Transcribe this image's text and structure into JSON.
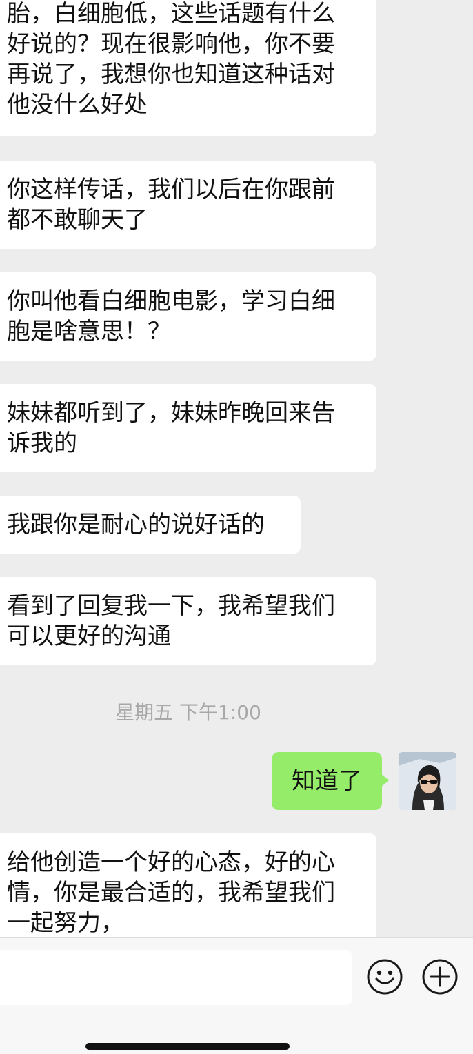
{
  "received_messages": [
    {
      "lines": [
        "胎，白细胞低，这些话题有什么",
        "好说的？现在很影响他，你不要",
        "再说了，我想你也知道这种话对",
        "他没什么好处"
      ]
    },
    {
      "lines": [
        "你这样传话，我们以后在你跟前",
        "都不敢聊天了"
      ]
    },
    {
      "lines": [
        "你叫他看白细胞电影，学习白细",
        "胞是啥意思！？"
      ]
    },
    {
      "lines": [
        "妹妹都听到了，妹妹昨晚回来告",
        "诉我的"
      ]
    },
    {
      "lines": [
        "我跟你是耐心的说好话的"
      ]
    },
    {
      "lines": [
        "看到了回复我一下，我希望我们",
        "可以更好的沟通"
      ]
    },
    {
      "lines": [
        "给他创造一个好的心态，好的心",
        "情，你是最合适的，我希望我们",
        "一起努力，"
      ]
    }
  ],
  "timestamp": "星期五 下午1:00",
  "sent_message": "知道了",
  "colors": {
    "chat_background": "#ededed",
    "received_bubble": "#ffffff",
    "sent_bubble": "#95ec69",
    "timestamp_text": "#a8a8a8"
  },
  "icons": {
    "emoji": "smiley-face-icon",
    "more": "plus-circle-icon"
  }
}
